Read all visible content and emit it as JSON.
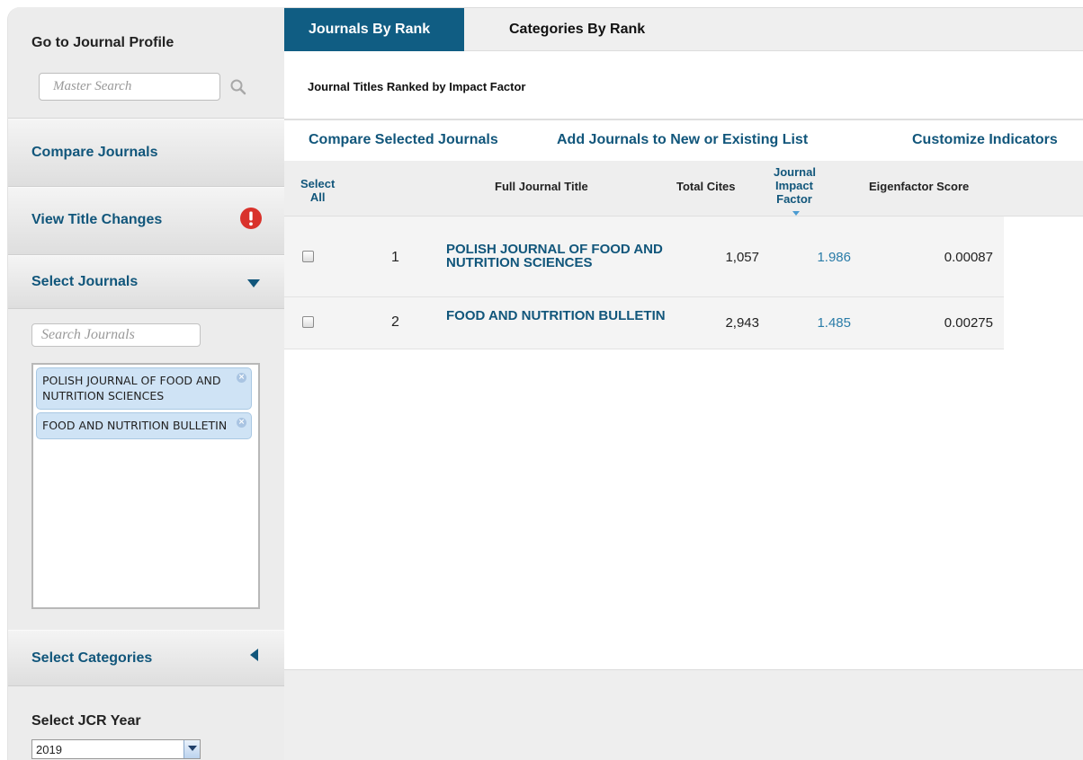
{
  "sidebar": {
    "goto_title": "Go to Journal Profile",
    "master_search_placeholder": "Master Search",
    "compare_journals": "Compare Journals",
    "view_title_changes": "View Title Changes",
    "select_journals": "Select Journals",
    "search_journals_placeholder": "Search Journals",
    "selected_journals": [
      {
        "label": "POLISH JOURNAL OF FOOD AND NUTRITION SCIENCES"
      },
      {
        "label": "FOOD AND NUTRITION BULLETIN"
      }
    ],
    "chip_close": "×",
    "select_categories": "Select Categories",
    "jcr_year_title": "Select JCR Year",
    "jcr_year_value": "2019"
  },
  "tabs": {
    "active": "Journals By Rank",
    "other": "Categories By Rank"
  },
  "main": {
    "subtitle": "Journal Titles Ranked by Impact Factor",
    "actions": {
      "compare": "Compare Selected Journals",
      "add_list": "Add Journals to New or Existing List",
      "customize": "Customize Indicators"
    }
  },
  "table": {
    "headers": {
      "select_all_1": "Select",
      "select_all_2": "All",
      "full_title": "Full Journal Title",
      "total_cites": "Total Cites",
      "jif_1": "Journal",
      "jif_2": "Impact",
      "jif_3": "Factor",
      "eigenfactor": "Eigenfactor Score"
    },
    "rows": [
      {
        "rank": "1",
        "title": "POLISH JOURNAL OF FOOD AND NUTRITION SCIENCES",
        "cites": "1,057",
        "jif": "1.986",
        "eigenfactor": "0.00087"
      },
      {
        "rank": "2",
        "title": "FOOD AND NUTRITION BULLETIN",
        "cites": "2,943",
        "jif": "1.485",
        "eigenfactor": "0.00275"
      }
    ]
  },
  "colors": {
    "accent": "#105d83",
    "link": "#11567b",
    "alert": "#d9322b"
  }
}
